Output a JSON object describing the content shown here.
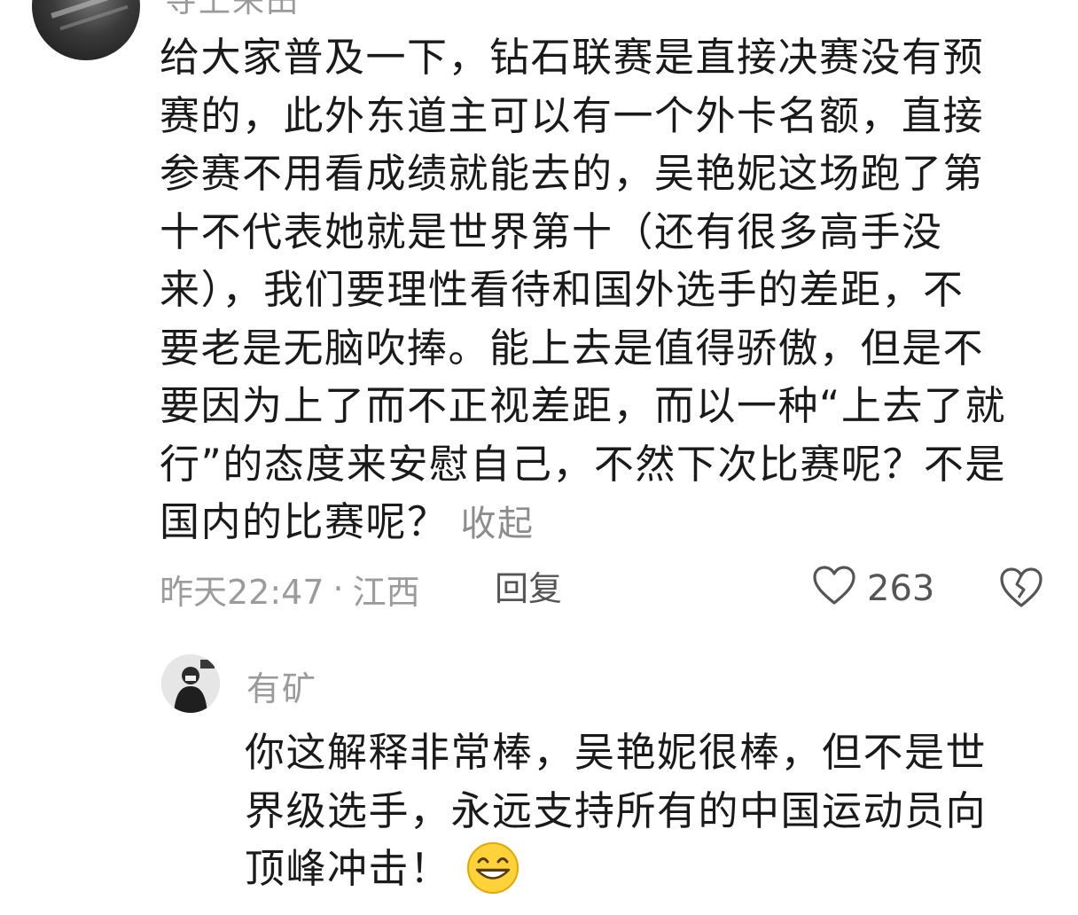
{
  "comment": {
    "username": "寺上来田",
    "lines": [
      "给大家普及一下，钻石联赛是直接决赛没有预",
      "赛的，此外东道主可以有一个外卡名额，直接",
      "参赛不用看成绩就能去的，吴艳妮这场跑了第",
      "十不代表她就是世界第十（还有很多高手没",
      "来），我们要理性看待和国外选手的差距，不",
      "要老是无脑吹捧。能上去是值得骄傲，但是不",
      "要因为上了而不正视差距，而以一种“上去了就",
      "行”的态度来安慰自己，不然下次比赛呢？不是",
      "国内的比赛呢？"
    ],
    "collapse_label": "收起",
    "time": "昨天22:47",
    "dot": "·",
    "location": "江西",
    "reply_label": "回复",
    "like_count": "263",
    "icons": {
      "like": "heart-outline-icon",
      "dislike": "broken-heart-icon"
    }
  },
  "reply": {
    "username": "有矿",
    "lines": [
      "你这解释非常棒，吴艳妮很棒，但不是世",
      "界级选手，永远支持所有的中国运动员向",
      "顶峰冲击！"
    ],
    "emoji": "grinning-face-emoji"
  },
  "colors": {
    "text": "#1a1a1a",
    "muted": "#9b9b9b",
    "icon": "#555555"
  }
}
